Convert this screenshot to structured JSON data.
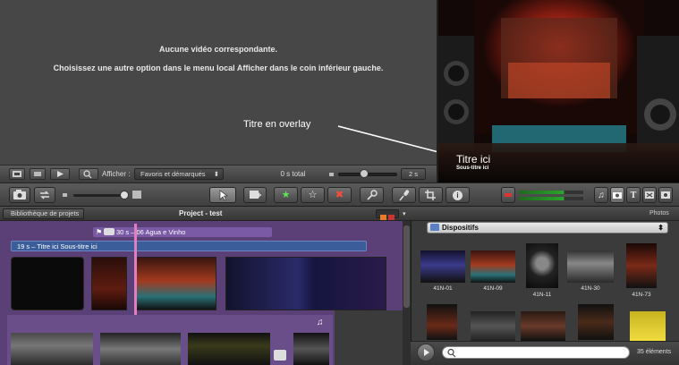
{
  "event_library": {
    "message_title": "Aucune vidéo correspondante.",
    "message_body": "Choisissez une autre option dans le menu local Afficher dans le coin inférieur gauche.",
    "annotation": "Titre en overlay",
    "afficher_label": "Afficher :",
    "afficher_value": "Favoris et démarqués",
    "total_label": "0 s total",
    "zoom_value": "2 s"
  },
  "viewer": {
    "title": "Titre ici",
    "subtitle": "Sous-titre ici"
  },
  "project": {
    "back_label": "Bibliothèque de projets",
    "title": "Project - test",
    "music_clip": "30 s – 06 Agua e Vinho",
    "title_clip": "19 s – Titre ici Sous-titre ici"
  },
  "events": {
    "tab_label": "Photos",
    "album": "Dispositifs",
    "thumbs": [
      "41N-01",
      "41N-09",
      "41N-11",
      "41N-30",
      "41N-73"
    ],
    "count": "35 éléments"
  },
  "icons": {
    "star": "★",
    "star_outline": "☆",
    "reject": "✖",
    "info": "i",
    "text_t": "T",
    "music": "♫"
  }
}
